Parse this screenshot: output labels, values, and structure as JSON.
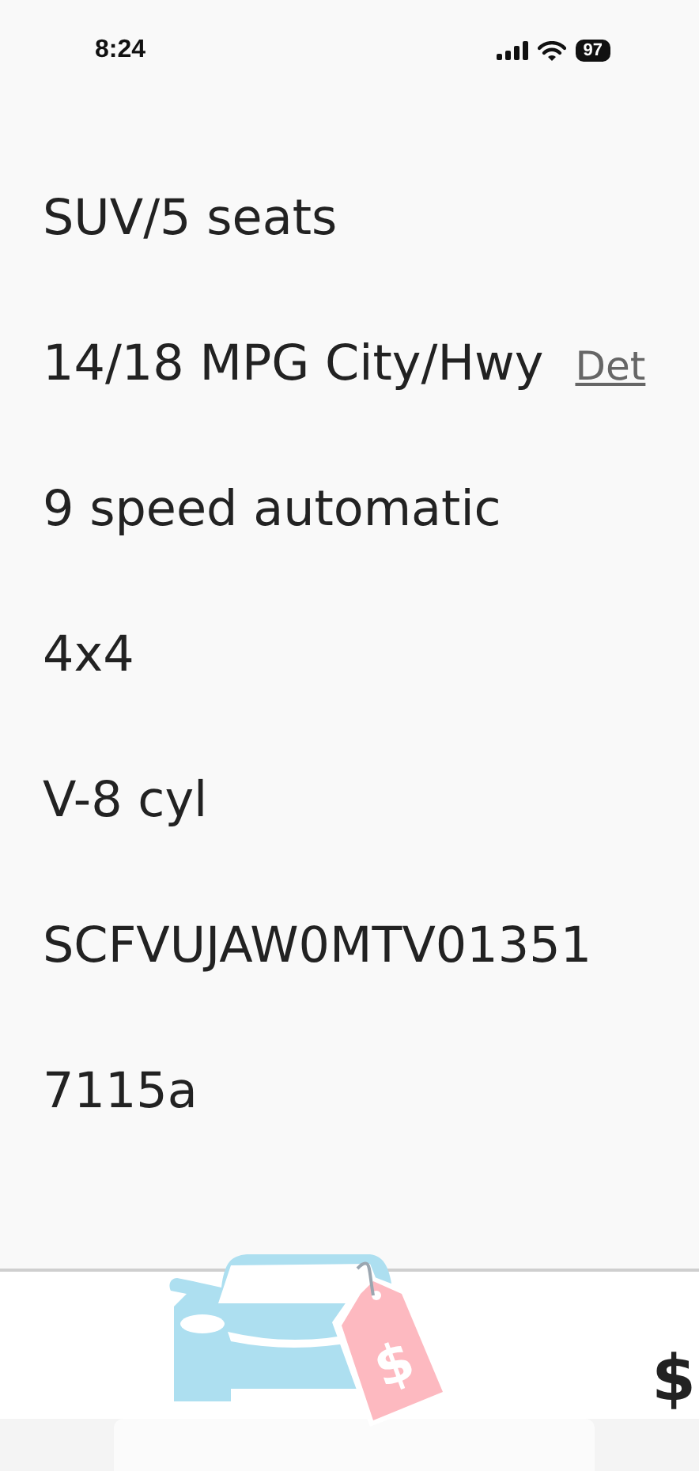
{
  "status_bar": {
    "time": "8:24",
    "battery": "97"
  },
  "specs": [
    {
      "text": "SUV/5 seats"
    },
    {
      "text": "14/18 MPG City/Hwy",
      "link": "Det"
    },
    {
      "text": "9 speed automatic"
    },
    {
      "text": "4x4"
    },
    {
      "text": "V-8 cyl"
    },
    {
      "text": "SCFVUJAW0MTV01351"
    },
    {
      "text": "7115a"
    }
  ],
  "footer": {
    "logo": {
      "kind": "picture",
      "tag_symbol": "$"
    },
    "price_symbol": "$"
  }
}
